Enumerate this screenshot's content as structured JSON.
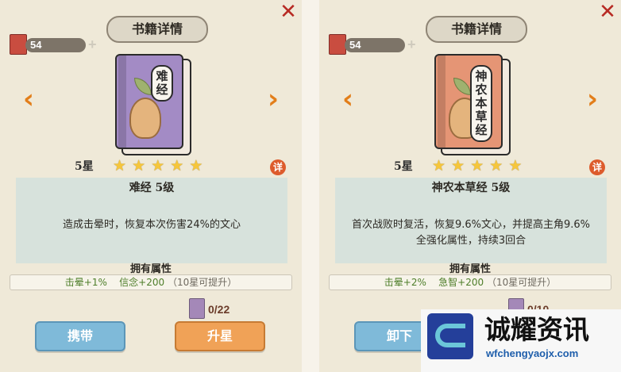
{
  "panels": {
    "left": {
      "title": "书籍详情",
      "close": "✕",
      "resource_count": "54",
      "book_name_label": "难经",
      "star_label": "5星",
      "stars": [
        "★",
        "★",
        "★",
        "★",
        "★"
      ],
      "detail_badge": "详",
      "book_heading": "难经   5级",
      "description": "造成击晕时，恢复本次伤害24%的文心",
      "attr_heading": "拥有属性",
      "attr_stat1": "击晕+1%",
      "attr_stat2": "信念+200",
      "attr_hint": "（10星可提升）",
      "fragment_value": "0/22",
      "carry_label": "携带",
      "upgrade_label": "升星",
      "colors": {
        "cover": "#a38bc5"
      }
    },
    "right": {
      "title": "书籍详情",
      "close": "✕",
      "resource_count": "54",
      "book_name_label": "神农本草经",
      "star_label": "5星",
      "stars": [
        "★",
        "★",
        "★",
        "★",
        "★"
      ],
      "detail_badge": "详",
      "book_heading": "神农本草经   5级",
      "description": "首次战败时复活，恢复9.6%文心，并提高主角9.6%全强化属性，持续3回合",
      "attr_heading": "拥有属性",
      "attr_stat1": "击晕+2%",
      "attr_stat2": "急智+200",
      "attr_hint": "（10星可提升）",
      "fragment_value": "0/10",
      "carry_label": "卸下",
      "colors": {
        "cover": "#e59575"
      }
    }
  },
  "watermark": {
    "name": "诚耀资讯",
    "url": "wfchengyaojx.com"
  }
}
